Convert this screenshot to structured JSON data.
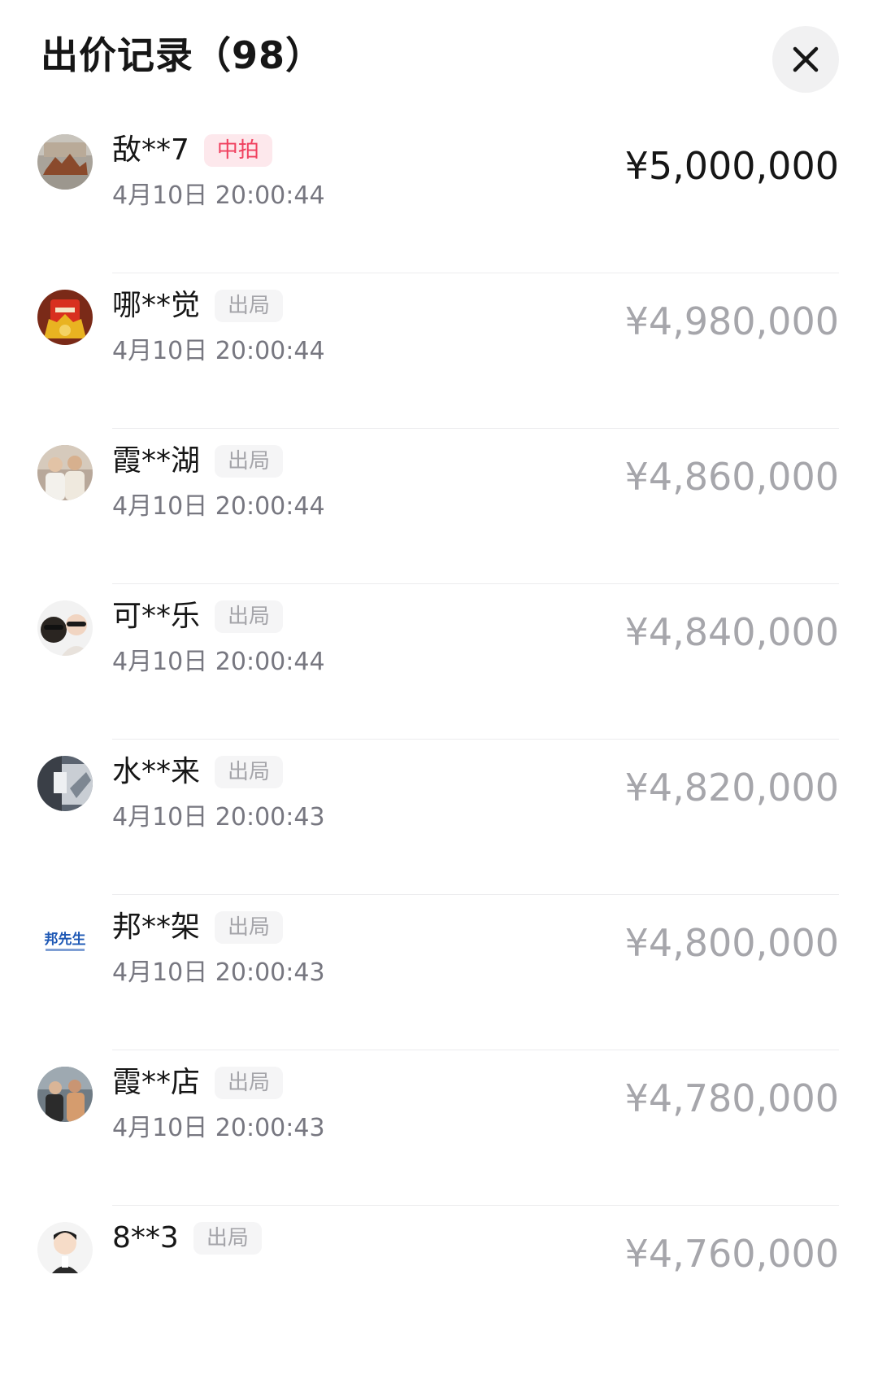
{
  "header": {
    "title": "出价记录（98）"
  },
  "bids": [
    {
      "username": "敌**7",
      "badge": "中拍",
      "time": "4月10日 20:00:44",
      "price": "¥5,000,000"
    },
    {
      "username": "哪**觉",
      "badge": "出局",
      "time": "4月10日 20:00:44",
      "price": "¥4,980,000"
    },
    {
      "username": "霞**湖",
      "badge": "出局",
      "time": "4月10日 20:00:44",
      "price": "¥4,860,000"
    },
    {
      "username": "可**乐",
      "badge": "出局",
      "time": "4月10日 20:00:44",
      "price": "¥4,840,000"
    },
    {
      "username": "水**来",
      "badge": "出局",
      "time": "4月10日 20:00:43",
      "price": "¥4,820,000"
    },
    {
      "username": "邦**架",
      "badge": "出局",
      "time": "4月10日 20:00:43",
      "price": "¥4,800,000"
    },
    {
      "username": "霞**店",
      "badge": "出局",
      "time": "4月10日 20:00:43",
      "price": "¥4,780,000"
    },
    {
      "username": "8**3",
      "badge": "出局",
      "time": "",
      "price": "¥4,760,000"
    }
  ],
  "avatar_logo_text": "邦先生",
  "colors": {
    "win_badge_text": "#f0415f",
    "win_badge_bg": "#fde8ec",
    "out_badge_text": "#a5a5aa",
    "top_price": "#161616",
    "other_price": "#a6a6ab"
  }
}
